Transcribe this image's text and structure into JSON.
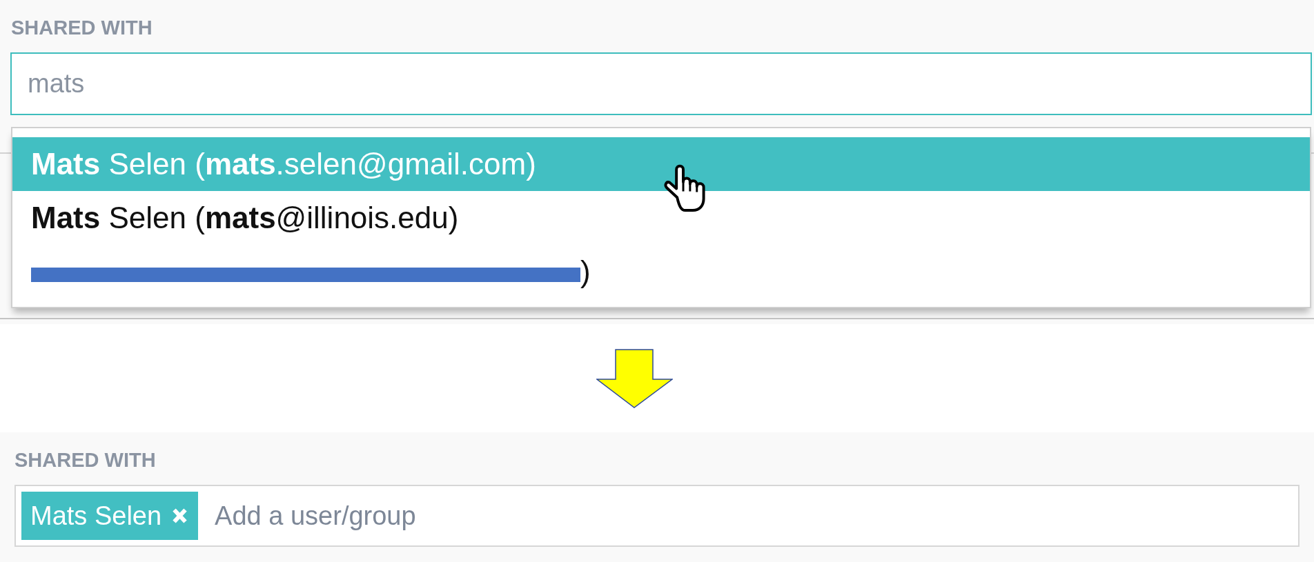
{
  "top_panel": {
    "label": "SHARED WITH",
    "search": {
      "value": "mats"
    },
    "suggestions": [
      {
        "text": "**Mats** Selen (**mats**.selen@gmail.com)",
        "selected": true,
        "redacted": false
      },
      {
        "text": "**Mats** Selen (**mats**@illinois.edu)",
        "selected": false,
        "redacted": false
      },
      {
        "text": ")",
        "selected": false,
        "redacted": true
      }
    ]
  },
  "bottom_panel": {
    "label": "SHARED WITH",
    "tags": [
      {
        "label": "Mats Selen"
      }
    ],
    "input": {
      "placeholder": "Add a user/group"
    }
  }
}
